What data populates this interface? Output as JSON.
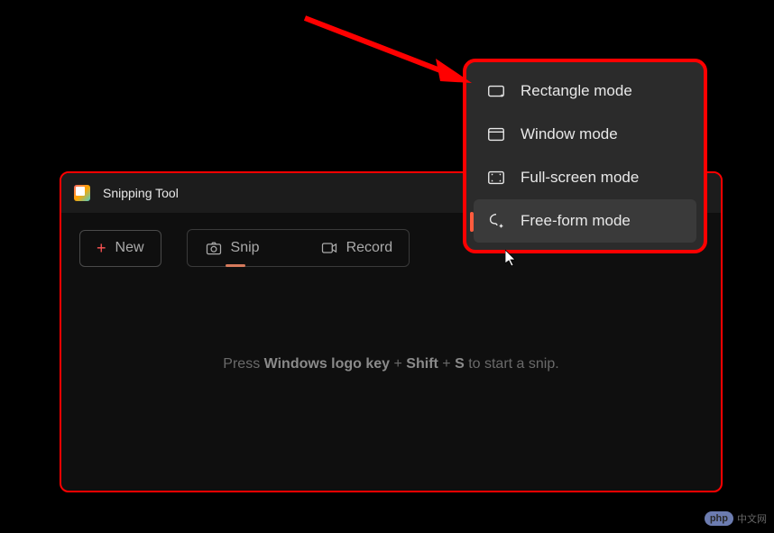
{
  "app": {
    "title": "Snipping Tool"
  },
  "toolbar": {
    "new_label": "New",
    "snip_label": "Snip",
    "record_label": "Record"
  },
  "hint": {
    "prefix": "Press ",
    "key1": "Windows logo key",
    "plus1": " + ",
    "key2": "Shift",
    "plus2": " + ",
    "key3": "S",
    "suffix": " to start a snip."
  },
  "menu": {
    "items": [
      {
        "label": "Rectangle mode",
        "icon": "rectangle",
        "selected": false
      },
      {
        "label": "Window mode",
        "icon": "window",
        "selected": false
      },
      {
        "label": "Full-screen mode",
        "icon": "fullscreen",
        "selected": false
      },
      {
        "label": "Free-form mode",
        "icon": "freeform",
        "selected": true
      }
    ]
  },
  "watermark": {
    "badge": "php",
    "text": "中文网"
  }
}
